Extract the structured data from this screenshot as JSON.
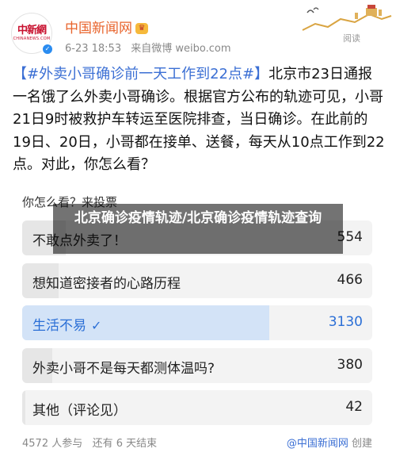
{
  "header": {
    "account_name": "中国新闻网",
    "avatar_logo_text": "中新網",
    "avatar_logo_sub": "CHINANEWS.COM",
    "date": "6-23 18:53",
    "source": "来自微博 weibo.com",
    "read_label": "阅读"
  },
  "post": {
    "topic": "【#外卖小哥确诊前一天工作到22点#】",
    "body": "北京市23日通报一名饿了么外卖小哥确诊。根据官方公布的轨迹可见，小哥21日9时被救护车转运至医院排查，当日确诊。在此前的19日、20日，小哥都在接单、送餐，每天从10点工作到22点。对此，你怎么看？"
  },
  "poll": {
    "title": "你怎么看？来投票",
    "options": [
      {
        "label": "不敢点外卖了！",
        "count": "554",
        "share": 0.125,
        "selected": false
      },
      {
        "label": "想知道密接者的心路历程",
        "count": "466",
        "share": 0.105,
        "selected": false
      },
      {
        "label": "生活不易",
        "count": "3130",
        "share": 0.705,
        "selected": true
      },
      {
        "label": "外卖小哥不是每天都测体温吗?",
        "count": "380",
        "share": 0.086,
        "selected": false
      },
      {
        "label": "其他（评论见）",
        "count": "42",
        "share": 0.009,
        "selected": false
      }
    ],
    "participants": "4572 人参与",
    "remaining": "还有 6 天结束",
    "creator": "@中国新闻网",
    "creator_suffix": "创建"
  },
  "overlay": {
    "title": "北京确诊疫情轨迹/北京确诊疫情轨迹查询"
  },
  "colors": {
    "brand": "#e8632b",
    "topic": "#3b6fd4",
    "selected": "#2b6fd6",
    "selected_fill": "#d3e3f7"
  }
}
